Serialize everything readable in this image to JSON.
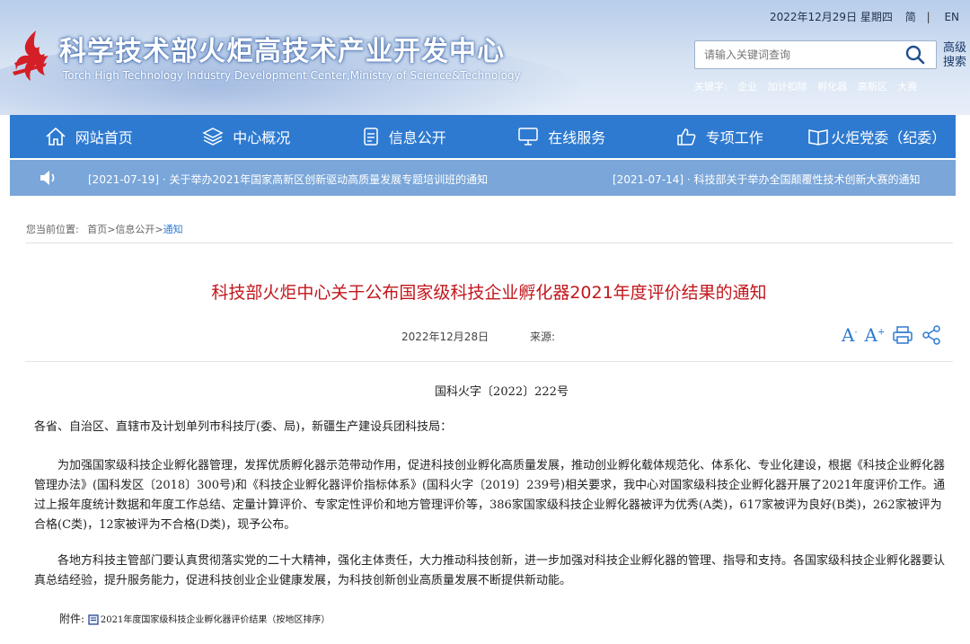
{
  "header": {
    "title": "科学技术部火炬高技术产业开发中心",
    "subtitle": "Torch High Technology Industry Development Center,Ministry of Science&Technology",
    "date": "2022年12月29日 星期四",
    "lang_cn": "简",
    "lang_en": "EN",
    "search_placeholder": "请输入关键词查询",
    "advanced_search": "高级搜索",
    "keywords_label": "关键字:",
    "keywords": [
      "企业",
      "加计扣除",
      "孵化器",
      "高新区",
      "大赛"
    ]
  },
  "nav": {
    "items": [
      "网站首页",
      "中心概况",
      "信息公开",
      "在线服务",
      "专项工作",
      "火炬党委（纪委）"
    ]
  },
  "ticker": {
    "item1": "[2021-07-19] · 关于举办2021年国家高新区创新驱动高质量发展专题培训班的通知",
    "item2": "[2021-07-14] · 科技部关于举办全国颠覆性技术创新大赛的通知"
  },
  "breadcrumb": {
    "label": "您当前位置:",
    "home": "首页",
    "sep1": ">",
    "info": "信息公开",
    "sep2": ">",
    "current": "通知"
  },
  "article": {
    "title": "科技部火炬中心关于公布国家级科技企业孵化器2021年度评价结果的通知",
    "date": "2022年12月28日",
    "source_label": "来源:",
    "tool_font_small": "A",
    "tool_font_large": "A",
    "doc_number": "国科火字〔2022〕222号",
    "salutation": "各省、自治区、直辖市及计划单列市科技厅(委、局)，新疆生产建设兵团科技局：",
    "para1": "为加强国家级科技企业孵化器管理，发挥优质孵化器示范带动作用，促进科技创业孵化高质量发展，推动创业孵化载体规范化、体系化、专业化建设，根据《科技企业孵化器管理办法》(国科发区〔2018〕300号)和《科技企业孵化器评价指标体系》(国科火字〔2019〕239号)相关要求，我中心对国家级科技企业孵化器开展了2021年度评价工作。通过上报年度统计数据和年度工作总结、定量计算评价、专家定性评价和地方管理评价等，386家国家级科技企业孵化器被评为优秀(A类)，617家被评为良好(B类)，262家被评为合格(C类)，12家被评为不合格(D类)，现予公布。",
    "para2": "各地方科技主管部门要认真贯彻落实党的二十大精神，强化主体责任，大力推动科技创新，进一步加强对科技企业孵化器的管理、指导和支持。各国家级科技企业孵化器要认真总结经验，提升服务能力，促进科技创业企业健康发展，为科技创新创业高质量发展不断提供新动能。",
    "attachment_label": "附件:",
    "attachment_file": "2021年度国家级科技企业孵化器评价结果（按地区排序）"
  },
  "colors": {
    "nav_bg": "#2e7ad0",
    "ticker_bg": "#7aa6d9",
    "title_red": "#c2161c"
  }
}
